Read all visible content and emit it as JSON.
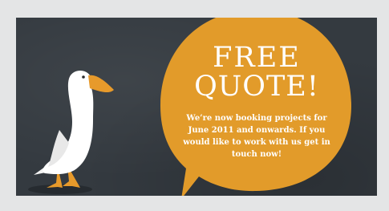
{
  "banner": {
    "headline_line1": "FREE",
    "headline_line2": "QUOTE!",
    "body": "We’re now booking projects for June 2011 and onwards. If you would like to work with us get in touch now!"
  },
  "colors": {
    "background": "#343a40",
    "bubble": "#e29b2a",
    "duck_body": "#ffffff",
    "duck_beak": "#e79a2b",
    "frame": "#e4e5e6"
  },
  "icons": {
    "duck": "duck-illustration",
    "speech_bubble": "speech-bubble"
  }
}
